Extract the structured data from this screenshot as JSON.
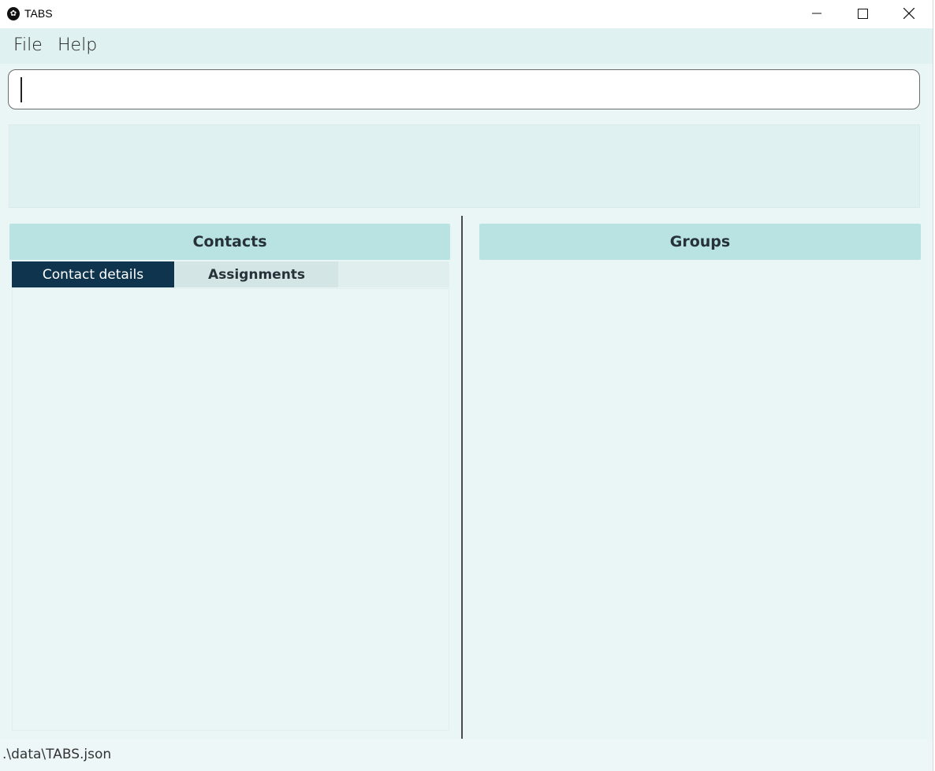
{
  "window": {
    "title": "TABS",
    "icon": "app-logo-icon",
    "controls": [
      "minimize-icon",
      "maximize-icon",
      "close-icon"
    ]
  },
  "menu": {
    "items": [
      {
        "label": "File"
      },
      {
        "label": "Help"
      }
    ]
  },
  "command_box": {
    "value": "",
    "placeholder": ""
  },
  "result_display": {
    "text": ""
  },
  "contacts_panel": {
    "title": "Contacts",
    "tabs": [
      {
        "label": "Contact details",
        "active": true
      },
      {
        "label": "Assignments",
        "active": false
      }
    ]
  },
  "groups_panel": {
    "title": "Groups"
  },
  "status_bar": {
    "path": ".\\data\\TABS.json"
  },
  "colors": {
    "background": "#eaf5f5",
    "header": "#b8e3e2",
    "active_tab": "#0e354d",
    "menubar": "#e0f1f1"
  }
}
